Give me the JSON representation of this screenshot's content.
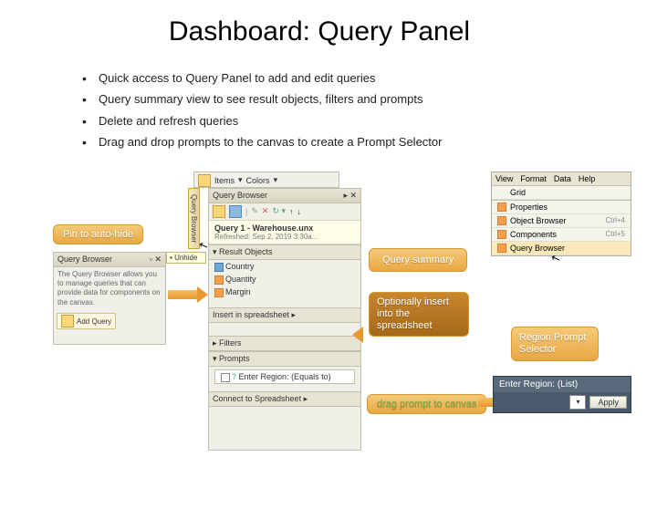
{
  "title": "Dashboard:  Query Panel",
  "bullets": [
    "Quick access to Query Panel to add and edit queries",
    "Query summary view to see result objects, filters and prompts",
    "Delete and refresh queries",
    "Drag and drop prompts to the canvas to create a Prompt Selector"
  ],
  "callouts": {
    "pin": "Pin to auto-hide",
    "summary": "Query summary",
    "insert": "Optionally insert into the spreadsheet",
    "drag": "drag prompt to canvas",
    "region": "Region Prompt Selector"
  },
  "left_browser": {
    "header": "Query Browser",
    "unhide": "Unhide",
    "desc": "The Query Browser allows you to manage queries that can provide data for components on the canvas.",
    "add_btn": "Add Query"
  },
  "top_menu": {
    "items": [
      "Items",
      "Colors"
    ],
    "marker": "▾"
  },
  "main_panel": {
    "header": "Query Browser",
    "pin_icons": "▸  ✕",
    "toolbar_icons": [
      "★",
      "✎",
      "✕",
      "↻",
      "↑",
      "↓"
    ],
    "query_name": "Query 1 - Warehouse.unx",
    "query_date": "Refreshed: Sep 2, 2019 3:30a...",
    "sections": {
      "result_objects": "Result Objects",
      "insert_spreadsheet": "Insert in spreadsheet  ▸",
      "filters": "Filters",
      "prompts": "Prompts",
      "connect": "Connect to Spreadsheet  ▸"
    },
    "result_items": [
      "Country",
      "Quantity",
      "Margin"
    ],
    "prompt_item": "Enter Region: (Equals to)"
  },
  "vert_label": "Query Browser",
  "view_menu": {
    "topbar": [
      "View",
      "Format",
      "Data",
      "Help"
    ],
    "items": [
      {
        "label": "Grid",
        "shortcut": "",
        "checked": false
      },
      {
        "label": "Properties",
        "shortcut": "",
        "checked": true
      },
      {
        "label": "Object Browser",
        "shortcut": "Ctrl+4",
        "checked": true
      },
      {
        "label": "Components",
        "shortcut": "Ctrl+5",
        "checked": true
      },
      {
        "label": "Query Browser",
        "shortcut": "",
        "checked": true
      }
    ]
  },
  "region_selector": {
    "header": "Enter Region: (List)",
    "dropdown": "▾",
    "apply": "Apply"
  }
}
